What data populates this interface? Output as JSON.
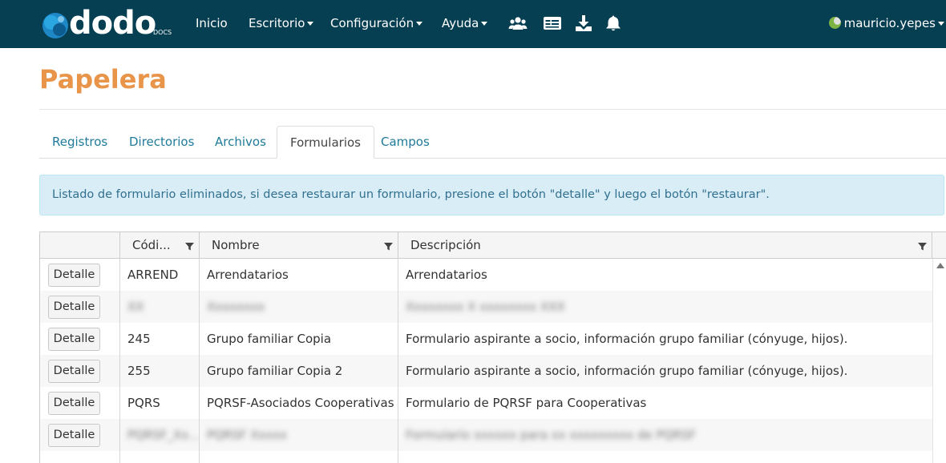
{
  "navbar": {
    "brand": "dodo",
    "brand_sub": "DOCS",
    "menu": [
      {
        "label": "Inicio",
        "dropdown": false
      },
      {
        "label": "Escritorio",
        "dropdown": true
      },
      {
        "label": "Configuración",
        "dropdown": true
      },
      {
        "label": "Ayuda",
        "dropdown": true
      }
    ],
    "icons": [
      "users-icon",
      "id-card-icon",
      "download-icon",
      "bell-icon"
    ],
    "user": "mauricio.yepes"
  },
  "page": {
    "title": "Papelera"
  },
  "tabs": [
    {
      "label": "Registros",
      "active": false
    },
    {
      "label": "Directorios",
      "active": false
    },
    {
      "label": "Archivos",
      "active": false
    },
    {
      "label": "Formularios",
      "active": true
    },
    {
      "label": "Campos",
      "active": false
    }
  ],
  "alert": {
    "text": "Listado de formulario eliminados, si desea restaurar un formulario, presione el botón \"detalle\" y luego el botón \"restaurar\"."
  },
  "grid": {
    "columns": [
      "",
      "Códi...",
      "Nombre",
      "Descripción"
    ],
    "action_label": "Detalle",
    "rows": [
      {
        "codigo": "ARREND",
        "nombre": "Arrendatarios",
        "descripcion": "Arrendatarios",
        "blurred": false
      },
      {
        "codigo": "XX",
        "nombre": "Xxxxxxxx",
        "descripcion": "Xxxxxxxx X xxxxxxxx XXX",
        "blurred": true
      },
      {
        "codigo": "245",
        "nombre": "Grupo familiar Copia",
        "descripcion": "Formulario aspirante a socio, información grupo familiar (cónyuge, hijos).",
        "blurred": false
      },
      {
        "codigo": "255",
        "nombre": "Grupo familiar Copia 2",
        "descripcion": "Formulario aspirante a socio, información grupo familiar (cónyuge, hijos).",
        "blurred": false
      },
      {
        "codigo": "PQRS",
        "nombre": "PQRSF-Asociados Cooperativas",
        "descripcion": "Formulario de PQRSF para Cooperativas",
        "blurred": false
      },
      {
        "codigo": "PQRSF_Xx...",
        "nombre": "PQRSF Xxxxx",
        "descripcion": "Formulario xxxxxx para xx xxxxxxxxx de PQRSF",
        "blurred": true
      }
    ]
  },
  "colors": {
    "navbar_bg": "#063e52",
    "title": "#e8954a",
    "tab_link": "#1f7a9a",
    "alert_bg": "#d9edf7",
    "alert_text": "#31708f"
  }
}
